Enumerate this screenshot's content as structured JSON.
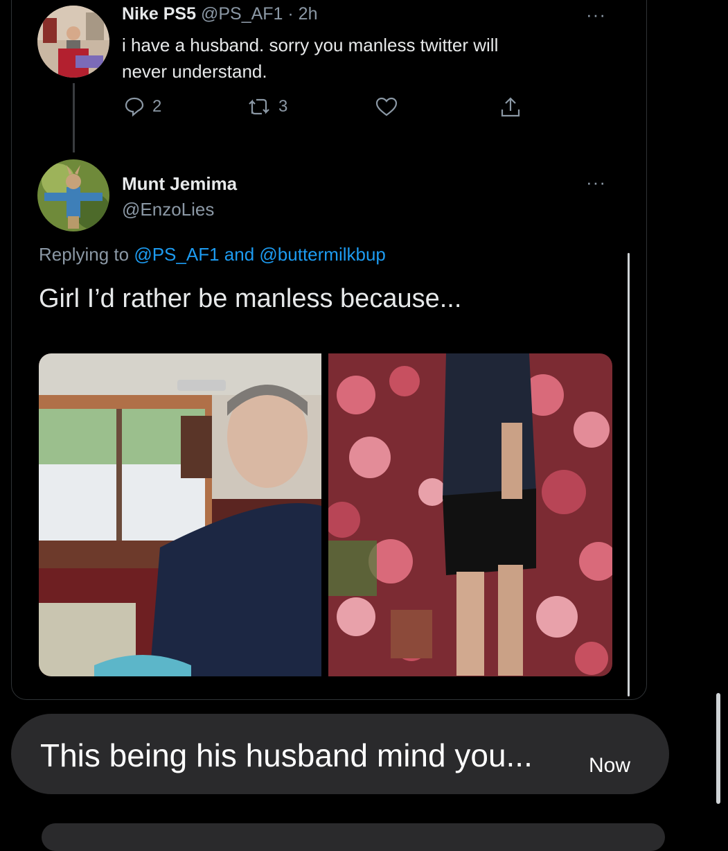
{
  "tweet1": {
    "display_name": "Nike PS5",
    "handle": "@PS_AF1",
    "time": "· 2h",
    "text_line1": "i have a husband. sorry you manless twitter will",
    "text_line2": "never understand.",
    "replies": "2",
    "retweets": "3",
    "more": "···"
  },
  "tweet2": {
    "display_name": "Munt Jemima",
    "handle": "@EnzoLies",
    "more": "···",
    "replying_prefix": "Replying to",
    "replying_user1": "@PS_AF1",
    "replying_and": "and",
    "replying_user2": "@buttermilkbup",
    "text": "Girl I’d rather be manless because..."
  },
  "message": {
    "text": "This being his husband mind you...",
    "time": "Now"
  },
  "colors": {
    "background": "#000000",
    "link": "#1d9bf0",
    "muted": "#8b98a5",
    "bubble": "#2a2a2c"
  },
  "icons": [
    "reply-icon",
    "retweet-icon",
    "like-icon",
    "share-icon",
    "more-icon"
  ]
}
